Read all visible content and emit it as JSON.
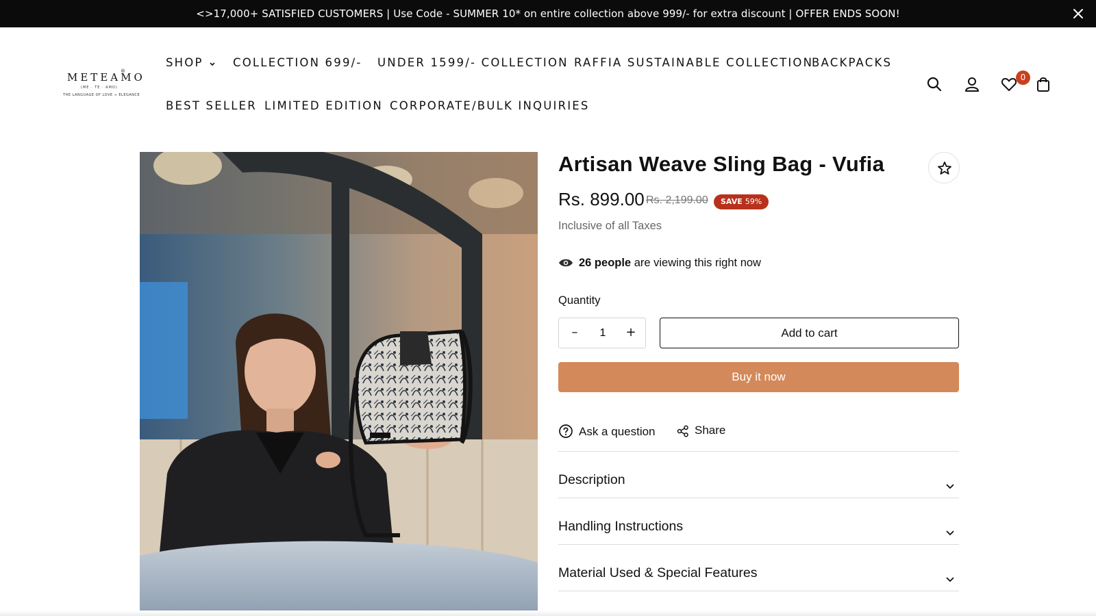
{
  "announcement": {
    "text": "<>17,000+ SATISFIED CUSTOMERS | Use Code - SUMMER 10* on entire collection above 999/- for extra discount | OFFER ENDS SOON!"
  },
  "logo": {
    "word": "METEAMO",
    "reg": "®",
    "sub1": "(ME · TE · AMO)",
    "sub2": "THE LANGUAGE OF LOVE ∞ ELEGANCE"
  },
  "nav": {
    "items": [
      {
        "label": "SHOP"
      },
      {
        "label": "COLLECTION 699/-"
      },
      {
        "label": "UNDER 1599/- COLLECTION"
      },
      {
        "label": "RAFFIA SUSTAINABLE COLLECTION"
      },
      {
        "label": "BACKPACKS"
      },
      {
        "label": "BEST SELLER"
      },
      {
        "label": "LIMITED EDITION"
      },
      {
        "label": "CORPORATE/BULK INQUIRIES"
      }
    ]
  },
  "header_icons": {
    "search": "search-icon",
    "account": "user-icon",
    "wishlist": "heart-icon",
    "wishlist_count": "0",
    "cart": "bag-icon"
  },
  "product": {
    "title": "Artisan Weave Sling Bag - Vufia",
    "price": "Rs. 899.00",
    "compare_price": "Rs. 2,199.00",
    "save_label": "SAVE",
    "save_percent": "59%",
    "tax_note": "Inclusive of all Taxes",
    "viewers_count": "26 people",
    "viewers_text": " are viewing this right now",
    "quantity_label": "Quantity",
    "quantity_value": "1",
    "add_to_cart": "Add to cart",
    "buy_now": "Buy it now",
    "ask_question": "Ask a question",
    "share": "Share",
    "accordions": [
      {
        "label": "Description"
      },
      {
        "label": "Handling Instructions"
      },
      {
        "label": "Material Used & Special Features"
      }
    ]
  },
  "colors": {
    "announcement_bg": "#0b0b0b",
    "buy_now_bg": "#d4895a",
    "save_badge_bg": "#b8311b",
    "wishlist_badge_bg": "#c8401f"
  }
}
